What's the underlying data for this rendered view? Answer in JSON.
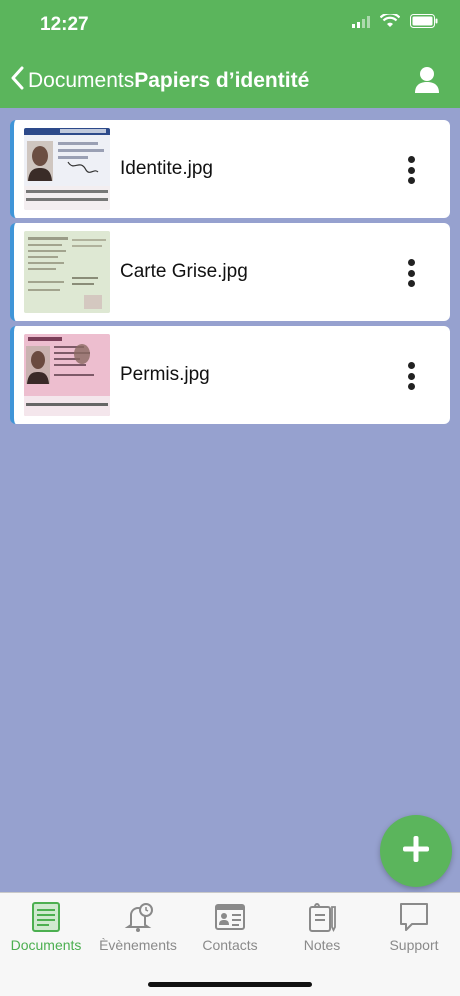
{
  "status_bar": {
    "time": "12:27"
  },
  "header": {
    "back_label": "Documents",
    "title": "Papiers d’identité",
    "back_icon": "chevron-left-icon",
    "profile_icon": "person-icon"
  },
  "documents": [
    {
      "name": "Identite.jpg",
      "thumbnail": "id-card"
    },
    {
      "name": "Carte Grise.jpg",
      "thumbnail": "registration"
    },
    {
      "name": "Permis.jpg",
      "thumbnail": "license"
    }
  ],
  "fab": {
    "icon": "plus-icon"
  },
  "tabs": [
    {
      "label": "Documents",
      "icon": "document-icon",
      "active": true
    },
    {
      "label": "Èvènements",
      "icon": "bell-clock-icon",
      "active": false
    },
    {
      "label": "Contacts",
      "icon": "contact-card-icon",
      "active": false
    },
    {
      "label": "Notes",
      "icon": "notepad-icon",
      "active": false
    },
    {
      "label": "Support",
      "icon": "chat-bubble-icon",
      "active": false
    }
  ],
  "colors": {
    "header": "#5bb55c",
    "background": "#96a1cf",
    "accent": "#3f95d8",
    "active_tab": "#4caf50"
  }
}
